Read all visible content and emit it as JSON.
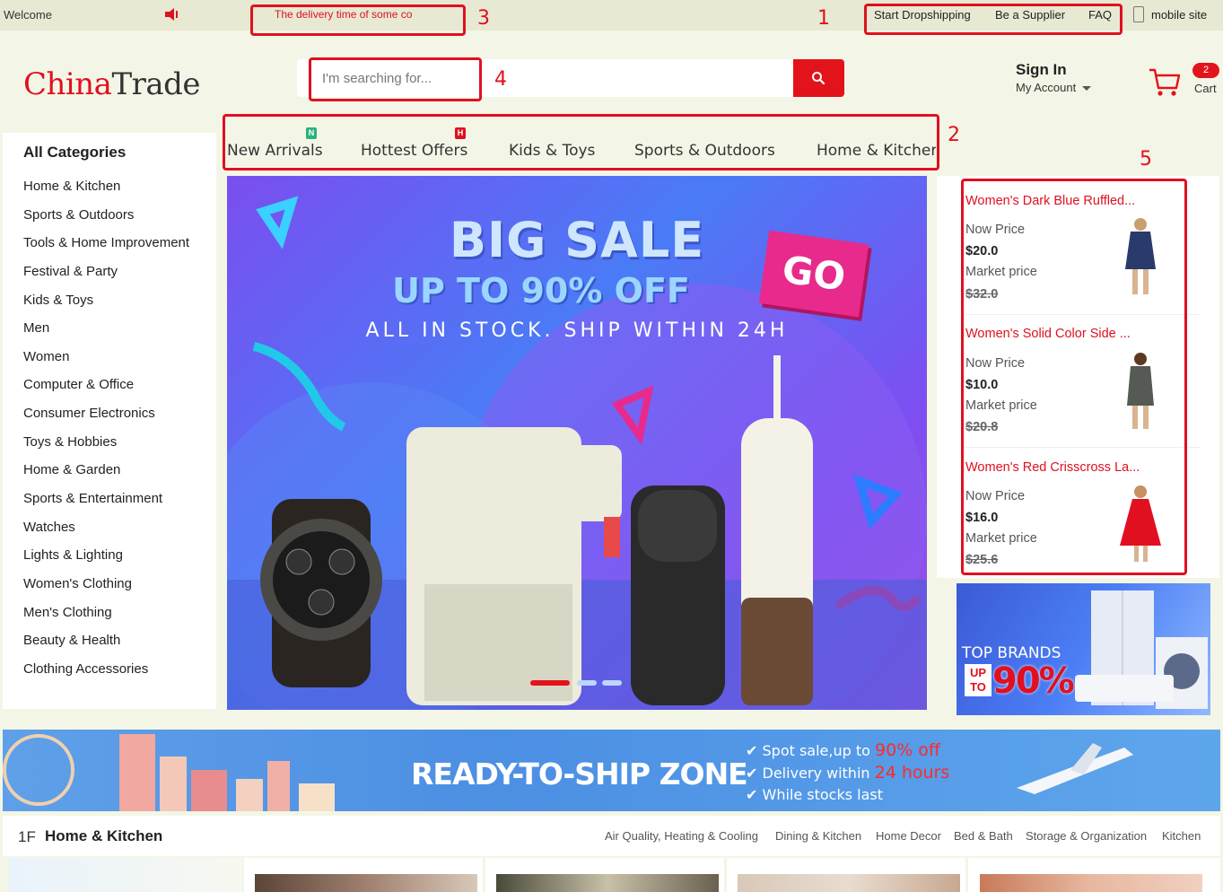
{
  "topbar": {
    "welcome": "Welcome",
    "notice": "The delivery time of some co",
    "links": [
      "Start Dropshipping",
      "Be a Supplier",
      "FAQ"
    ],
    "mobile": "mobile site"
  },
  "header": {
    "logo_prefix": "C",
    "logo_red": "hina",
    "logo_rest": "Trade",
    "search_placeholder": "I'm searching for...",
    "signin": "Sign In",
    "account": "My Account",
    "cart_count": "2",
    "cart_label": "Cart"
  },
  "annotations": [
    "1",
    "2",
    "3",
    "4",
    "5"
  ],
  "nav": {
    "tabs": [
      "New Arrivals",
      "Hottest Offers",
      "Kids & Toys",
      "Sports & Outdoors",
      "Home & Kitchen"
    ],
    "badges": [
      "N",
      "H"
    ]
  },
  "sidebar": {
    "title": "All Categories",
    "items": [
      "Home & Kitchen",
      "Sports & Outdoors",
      "Tools & Home Improvement",
      "Festival & Party",
      "Kids & Toys",
      "Men",
      "Women",
      "Computer & Office",
      "Consumer Electronics",
      "Toys & Hobbies",
      "Home & Garden",
      "Sports & Entertainment",
      "Watches",
      "Lights & Lighting",
      "Women's Clothing",
      "Men's Clothing",
      "Beauty & Health",
      "Clothing Accessories"
    ]
  },
  "hero": {
    "title": "BIG SALE",
    "subtitle": "UP TO 90% OFF",
    "tagline": "ALL IN STOCK. SHIP WITHIN 24H",
    "go": "GO"
  },
  "products": [
    {
      "name": "Women's Dark Blue Ruffled...",
      "now_label": "Now Price",
      "now_price": "$20.0",
      "market_label": "Market price",
      "market_price": "$32.0"
    },
    {
      "name": "Women's Solid Color Side ...",
      "now_label": "Now Price",
      "now_price": "$10.0",
      "market_label": "Market price",
      "market_price": "$20.8"
    },
    {
      "name": "Women's Red Crisscross La...",
      "now_label": "Now Price",
      "now_price": "$16.0",
      "market_label": "Market price",
      "market_price": "$25.6"
    }
  ],
  "brands": {
    "title": "TOP BRANDS",
    "up": "UP",
    "to": "TO",
    "percent": "90%"
  },
  "ready": {
    "title": "READY-TO-SHIP ZONE",
    "line1_pre": "Spot sale,up to ",
    "line1_hl": "90% off",
    "line2_pre": "Delivery within ",
    "line2_hl": "24 hours",
    "line3": "While stocks last"
  },
  "floor": {
    "number": "1F",
    "title": "Home & Kitchen",
    "links": [
      "Air Quality, Heating & Cooling",
      "Dining & Kitchen",
      "Home Decor",
      "Bed & Bath",
      "Storage & Organization",
      "Kitchen"
    ]
  },
  "colors": {
    "accent": "#e3131b",
    "annotation": "#e01020"
  }
}
